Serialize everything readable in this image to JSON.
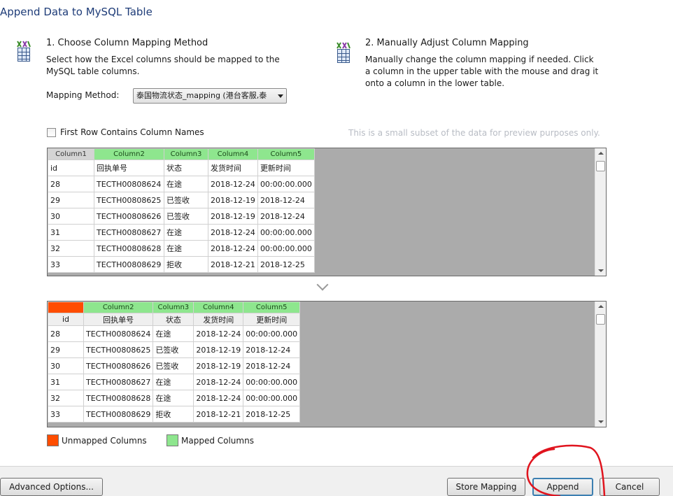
{
  "window": {
    "title": "Append Data to MySQL Table"
  },
  "icons": {
    "step1": "column-mapping-icon",
    "step2": "column-mapping-icon",
    "chevron": "chevron-down-icon"
  },
  "step1": {
    "title": "1. Choose Column Mapping Method",
    "desc_line1": "Select how the Excel columns should be mapped to the",
    "desc_line2": "MySQL table columns.",
    "mapping_label": "Mapping Method:",
    "mapping_value": "泰国物流状态_mapping (港台客服,泰"
  },
  "step2": {
    "title": "2. Manually Adjust Column Mapping",
    "desc_line1": "Manually change the column mapping if needed. Click",
    "desc_line2": "a column in the upper table with the mouse and drag it",
    "desc_line3": "onto a column in the lower table."
  },
  "options": {
    "first_row_label": "First Row Contains Column Names",
    "preview_note": "This is a small subset of the data for preview purposes only."
  },
  "colors": {
    "mapped": "#8ee68e",
    "unmapped": "#ff4d00",
    "grid_bg": "#ababab"
  },
  "upper_table": {
    "headers": [
      "Column1",
      "Column2",
      "Column3",
      "Column4",
      "Column5"
    ],
    "rows": [
      [
        "id",
        "回执单号",
        "状态",
        "发货时间",
        "更新时间"
      ],
      [
        "28",
        "TECTH00808624",
        "在途",
        "2018-12-24",
        "00:00:00.000"
      ],
      [
        "29",
        "TECTH00808625",
        "已签收",
        "2018-12-19",
        "2018-12-24"
      ],
      [
        "30",
        "TECTH00808626",
        "已签收",
        "2018-12-19",
        "2018-12-24"
      ],
      [
        "31",
        "TECTH00808627",
        "在途",
        "2018-12-24",
        "00:00:00.000"
      ],
      [
        "32",
        "TECTH00808628",
        "在途",
        "2018-12-24",
        "00:00:00.000"
      ],
      [
        "33",
        "TECTH00808629",
        "拒收",
        "2018-12-21",
        "2018-12-25"
      ]
    ]
  },
  "lower_table": {
    "headers": [
      "",
      "Column2",
      "Column3",
      "Column4",
      "Column5"
    ],
    "field_names": [
      "id",
      "回执单号",
      "状态",
      "发货时间",
      "更新时间"
    ],
    "rows": [
      [
        "28",
        "TECTH00808624",
        "在途",
        "2018-12-24",
        "00:00:00.000"
      ],
      [
        "29",
        "TECTH00808625",
        "已签收",
        "2018-12-19",
        "2018-12-24"
      ],
      [
        "30",
        "TECTH00808626",
        "已签收",
        "2018-12-19",
        "2018-12-24"
      ],
      [
        "31",
        "TECTH00808627",
        "在途",
        "2018-12-24",
        "00:00:00.000"
      ],
      [
        "32",
        "TECTH00808628",
        "在途",
        "2018-12-24",
        "00:00:00.000"
      ],
      [
        "33",
        "TECTH00808629",
        "拒收",
        "2018-12-21",
        "2018-12-25"
      ]
    ]
  },
  "legend": {
    "unmapped": "Unmapped Columns",
    "mapped": "Mapped Columns"
  },
  "buttons": {
    "advanced": "Advanced Options...",
    "store_mapping": "Store Mapping",
    "append": "Append",
    "cancel": "Cancel"
  }
}
